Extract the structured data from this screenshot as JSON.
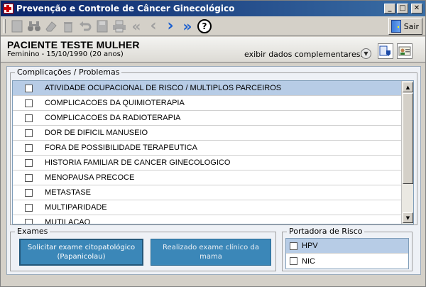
{
  "window": {
    "title": "Prevenção e Controle de Câncer Ginecológico",
    "controls": {
      "minimize": "_",
      "maximize": "□",
      "close": "✕"
    }
  },
  "toolbar": {
    "icons": [
      "new-icon",
      "search-binoculars-icon",
      "edit-eraser-icon",
      "delete-trash-icon",
      "undo-icon",
      "save-disk-icon",
      "print-icon",
      "first-icon",
      "previous-icon",
      "next-icon",
      "last-icon",
      "help-icon"
    ],
    "first_glyph": "«",
    "prev_glyph": "‹",
    "next_glyph": "›",
    "last_glyph": "»",
    "help_glyph": "?",
    "sair_label": "Sair"
  },
  "patient": {
    "name": "PACIENTE TESTE MULHER",
    "info": "Feminino - 15/10/1990 (20 anos)",
    "more_link": "exibir dados complementares...",
    "expand_glyph": "▼"
  },
  "complicacoes": {
    "legend": "Complicações / Problemas",
    "items": [
      {
        "label": "ATIVIDADE OCUPACIONAL DE RISCO / MULTIPLOS PARCEIROS",
        "checked": false,
        "selected": true
      },
      {
        "label": "COMPLICACOES DA QUIMIOTERAPIA",
        "checked": false,
        "selected": false
      },
      {
        "label": "COMPLICACOES DA RADIOTERAPIA",
        "checked": false,
        "selected": false
      },
      {
        "label": "DOR DE DIFICIL MANUSEIO",
        "checked": false,
        "selected": false
      },
      {
        "label": "FORA DE POSSIBILIDADE TERAPEUTICA",
        "checked": false,
        "selected": false
      },
      {
        "label": "HISTORIA FAMILIAR DE CANCER GINECOLOGICO",
        "checked": false,
        "selected": false
      },
      {
        "label": "MENOPAUSA PRECOCE",
        "checked": false,
        "selected": false
      },
      {
        "label": "METASTASE",
        "checked": false,
        "selected": false
      },
      {
        "label": "MULTIPARIDADE",
        "checked": false,
        "selected": false
      },
      {
        "label": "MUTILACAO",
        "checked": false,
        "selected": false
      }
    ],
    "scroll_up": "▲",
    "scroll_down": "▼"
  },
  "exames": {
    "legend": "Exames",
    "btn_citopatologico_line1": "Solicitar exame citopatológico",
    "btn_citopatologico_line2": "(Papanicolau)",
    "btn_clinico": "Realizado exame clínico da mama"
  },
  "risco": {
    "legend": "Portadora de Risco",
    "items": [
      {
        "label": "HPV",
        "checked": false,
        "selected": true
      },
      {
        "label": "NIC",
        "checked": false,
        "selected": false
      }
    ]
  },
  "colors": {
    "title_bar_start": "#0a246a",
    "title_bar_end": "#3a6ea5",
    "selection": "#b7cce6",
    "action_button": "#3b87b8"
  }
}
